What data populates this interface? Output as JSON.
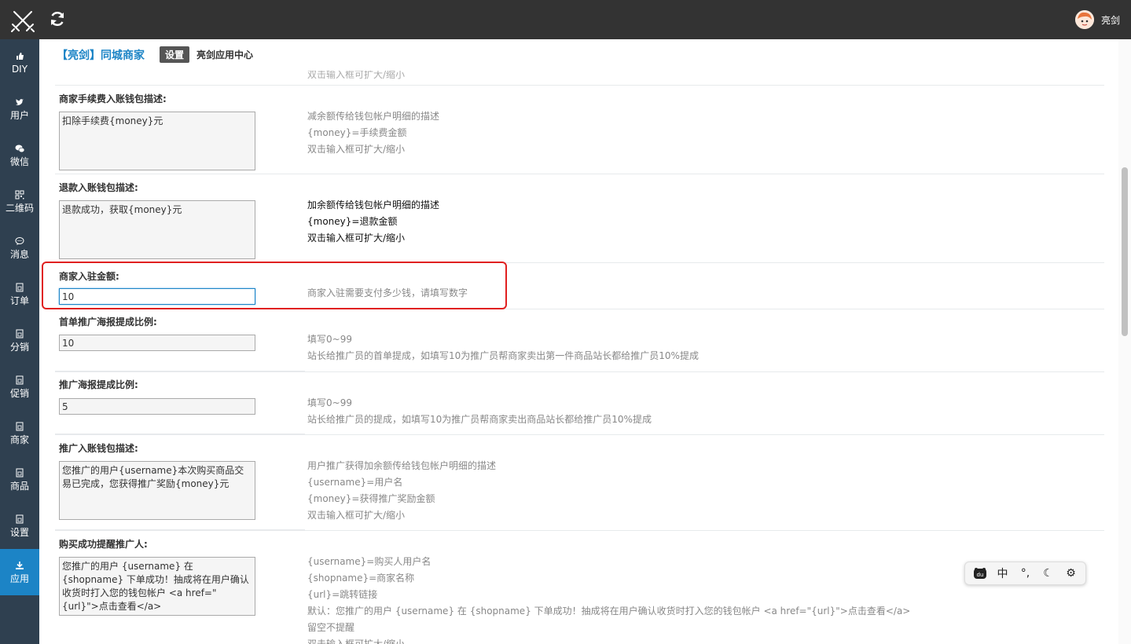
{
  "topbar": {
    "username": "亮剑"
  },
  "sidebar": {
    "items": [
      {
        "label": "DIY",
        "icon": "thumbs-up-icon"
      },
      {
        "label": "用户",
        "icon": "twitter-bird-icon"
      },
      {
        "label": "微信",
        "icon": "wechat-icon"
      },
      {
        "label": "二维码",
        "icon": "qrcode-icon"
      },
      {
        "label": "消息",
        "icon": "message-icon"
      },
      {
        "label": "订单",
        "icon": "order-icon"
      },
      {
        "label": "分销",
        "icon": "distribution-icon"
      },
      {
        "label": "促销",
        "icon": "promotion-icon"
      },
      {
        "label": "商家",
        "icon": "merchant-icon"
      },
      {
        "label": "商品",
        "icon": "goods-icon"
      },
      {
        "label": "设置",
        "icon": "settings-icon"
      },
      {
        "label": "应用",
        "icon": "download-icon"
      }
    ],
    "active_index": 11,
    "active_color": "#1c84c6"
  },
  "header": {
    "app_title": "【亮剑】同城商家",
    "tab_settings": "设置",
    "app_center": "亮剑应用中心"
  },
  "form": {
    "cut_text": "双击输入框可扩大/缩小",
    "rows": [
      {
        "label": "商家手续费入账钱包描述:",
        "value": "扣除手续费{money}元",
        "help": [
          "减余额传给钱包帐户明细的描述",
          "{money}=手续费金额",
          "双击输入框可扩大/缩小"
        ]
      },
      {
        "label": "退款入账钱包描述:",
        "value": "退款成功，获取{money}元",
        "help": [
          "加余额传给钱包帐户明细的描述",
          "{money}=退款金额",
          "双击输入框可扩大/缩小"
        ]
      },
      {
        "label": "商家入驻金额:",
        "value": "10",
        "help": [
          "商家入驻需要支付多少钱，请填写数字"
        ]
      },
      {
        "label": "首单推广海报提成比例:",
        "value": "10",
        "help": [
          "填写0~99",
          "站长给推广员的首单提成，如填写10为推广员帮商家卖出第一件商品站长都给推广员10%提成"
        ]
      },
      {
        "label": "推广海报提成比例:",
        "value": "5",
        "help": [
          "填写0~99",
          "站长给推广员的提成，如填写10为推广员帮商家卖出商品站长都给推广员10%提成"
        ]
      },
      {
        "label": "推广入账钱包描述:",
        "value": "您推广的用户{username}本次购买商品交易已完成，您获得推广奖励{money}元",
        "help": [
          "用户推广获得加余额传给钱包帐户明细的描述",
          "{username}=用户名",
          "{money}=获得推广奖励金额",
          "双击输入框可扩大/缩小"
        ]
      },
      {
        "label": "购买成功提醒推广人:",
        "value": "您推广的用户 {username} 在 {shopname} 下单成功！抽成将在用户确认收货时打入您的钱包帐户 <a href=\"{url}\">点击查看</a>",
        "help": [
          "{username}=购买人用户名",
          "{shopname}=商家名称",
          "{url}=跳转链接",
          "默认：您推广的用户 {username} 在 {shopname} 下单成功！抽成将在用户确认收货时打入您的钱包帐户 <a href=\"{url}\">点击查看</a>",
          "留空不提醒",
          "双击输入框可扩大/缩小"
        ]
      }
    ]
  },
  "ime": {
    "lang": "中",
    "punct": "°,",
    "moon": "☾",
    "gear": "⚙",
    "logo": "du"
  },
  "colors": {
    "accent": "#1c84c6",
    "sidebar_bg": "#2f4050",
    "topbar_bg": "#333333",
    "highlight": "#e02020"
  }
}
